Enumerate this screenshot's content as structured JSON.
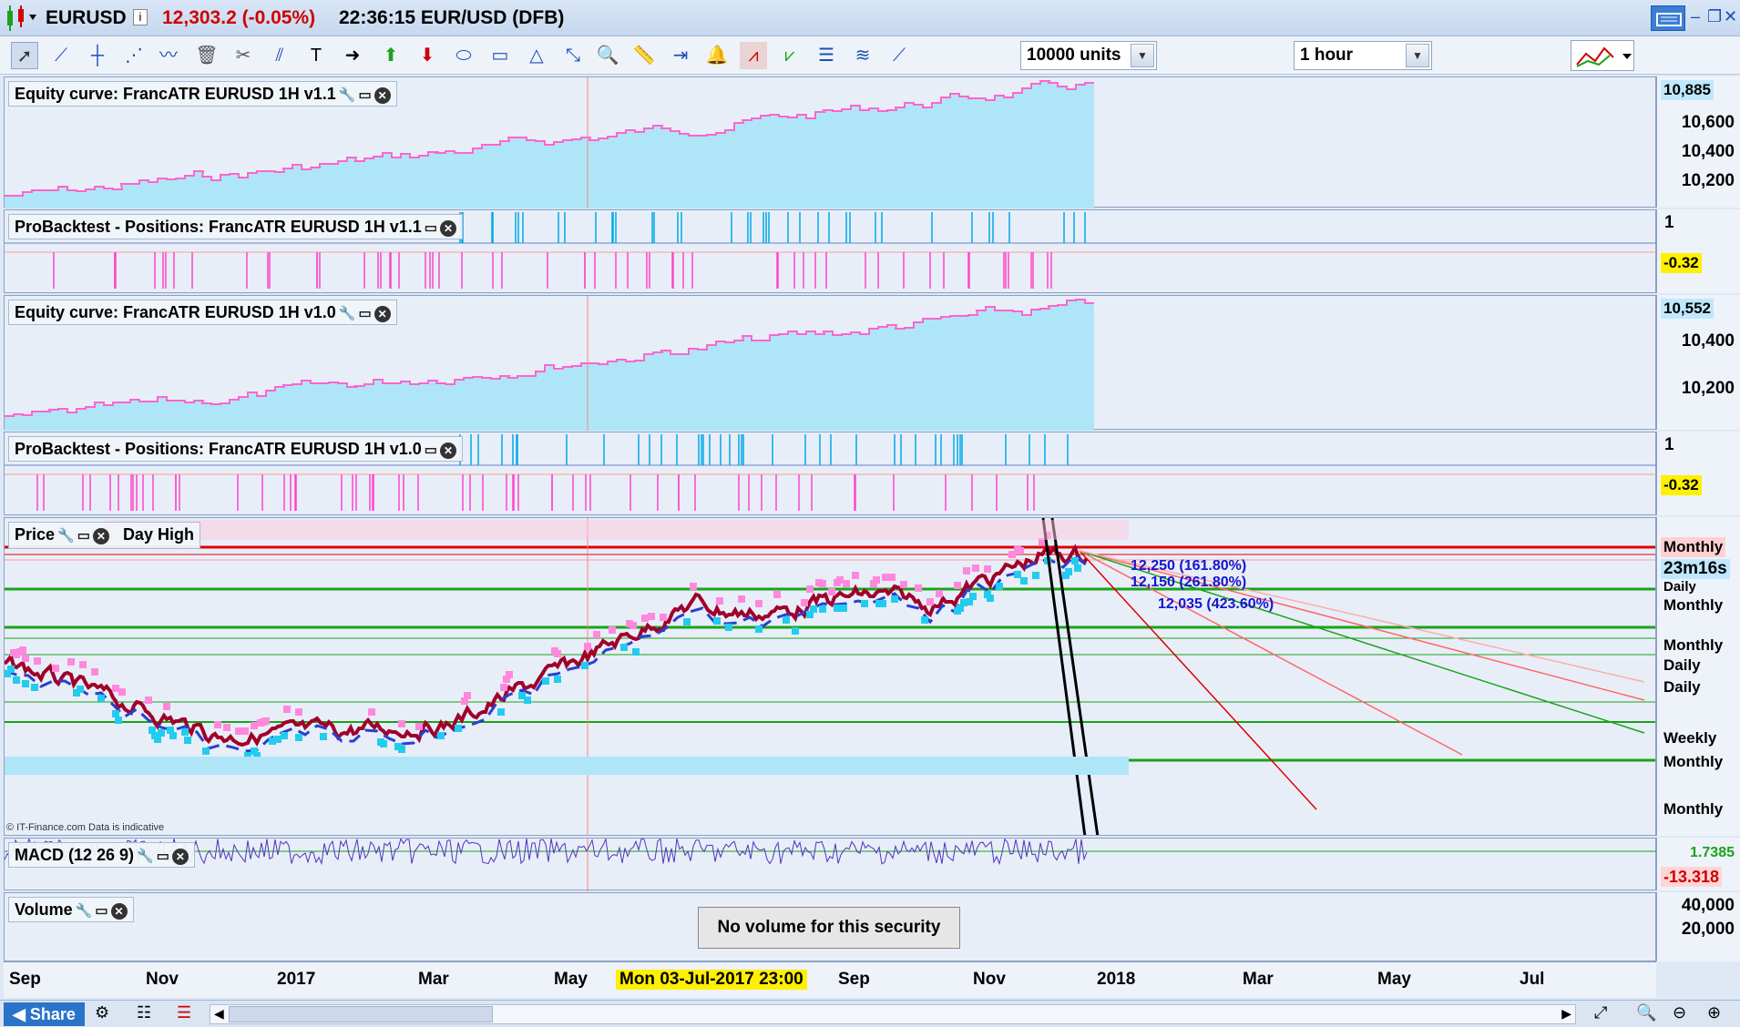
{
  "header": {
    "symbol": "EURUSD",
    "price": "12,303.2 (-0.05%)",
    "time": "22:36:15",
    "instrument": "EUR/USD (DFB)"
  },
  "toolbar": {
    "units": "10000 units",
    "timeframe": "1 hour"
  },
  "panels": {
    "equity1": {
      "title": "Equity curve: FrancATR EURUSD 1H v1.1",
      "axis": [
        "10,885",
        "10,600",
        "10,400",
        "10,200"
      ]
    },
    "pos1": {
      "title": "ProBacktest - Positions: FrancATR EURUSD 1H v1.1",
      "axis_top": "1",
      "axis_val": "-0.32"
    },
    "equity2": {
      "title": "Equity curve: FrancATR EURUSD 1H v1.0",
      "axis": [
        "10,552",
        "10,400",
        "10,200"
      ]
    },
    "pos2": {
      "title": "ProBacktest - Positions: FrancATR EURUSD 1H v1.0",
      "axis_top": "1",
      "axis_val": "-0.32"
    },
    "price": {
      "title": "Price",
      "day_high": "Day High",
      "countdown": "23m16s",
      "levels": [
        "Monthly",
        "Daily",
        "Monthly",
        "Monthly",
        "Daily",
        "Daily",
        "Weekly",
        "Monthly",
        "Monthly"
      ],
      "annotations": [
        "12,250 (161.80%)",
        "12,150 (261.80%)",
        "12,035 (423.60%)"
      ]
    },
    "macd": {
      "title": "MACD (12 26 9)",
      "axis": [
        "1.7385",
        "-13.318"
      ]
    },
    "volume": {
      "title": "Volume",
      "axis": [
        "40,000",
        "20,000"
      ],
      "message": "No volume for this security"
    }
  },
  "xaxis": {
    "labels": [
      "Sep",
      "Nov",
      "2017",
      "Mar",
      "May",
      "Sep",
      "Nov",
      "2018",
      "Mar",
      "May",
      "Jul"
    ],
    "cursor": "Mon 03-Jul-2017 23:00"
  },
  "footer": {
    "share": "Share",
    "credit": "© IT-Finance.com Data is indicative"
  },
  "colors": {
    "equity_fill": "#aee6f8",
    "equity_line": "#ff66cc",
    "position_long": "#00a8e8",
    "position_short": "#ff44cc",
    "support": "#1aa31a",
    "resistance": "#e00000",
    "candle": "#a0002a"
  }
}
